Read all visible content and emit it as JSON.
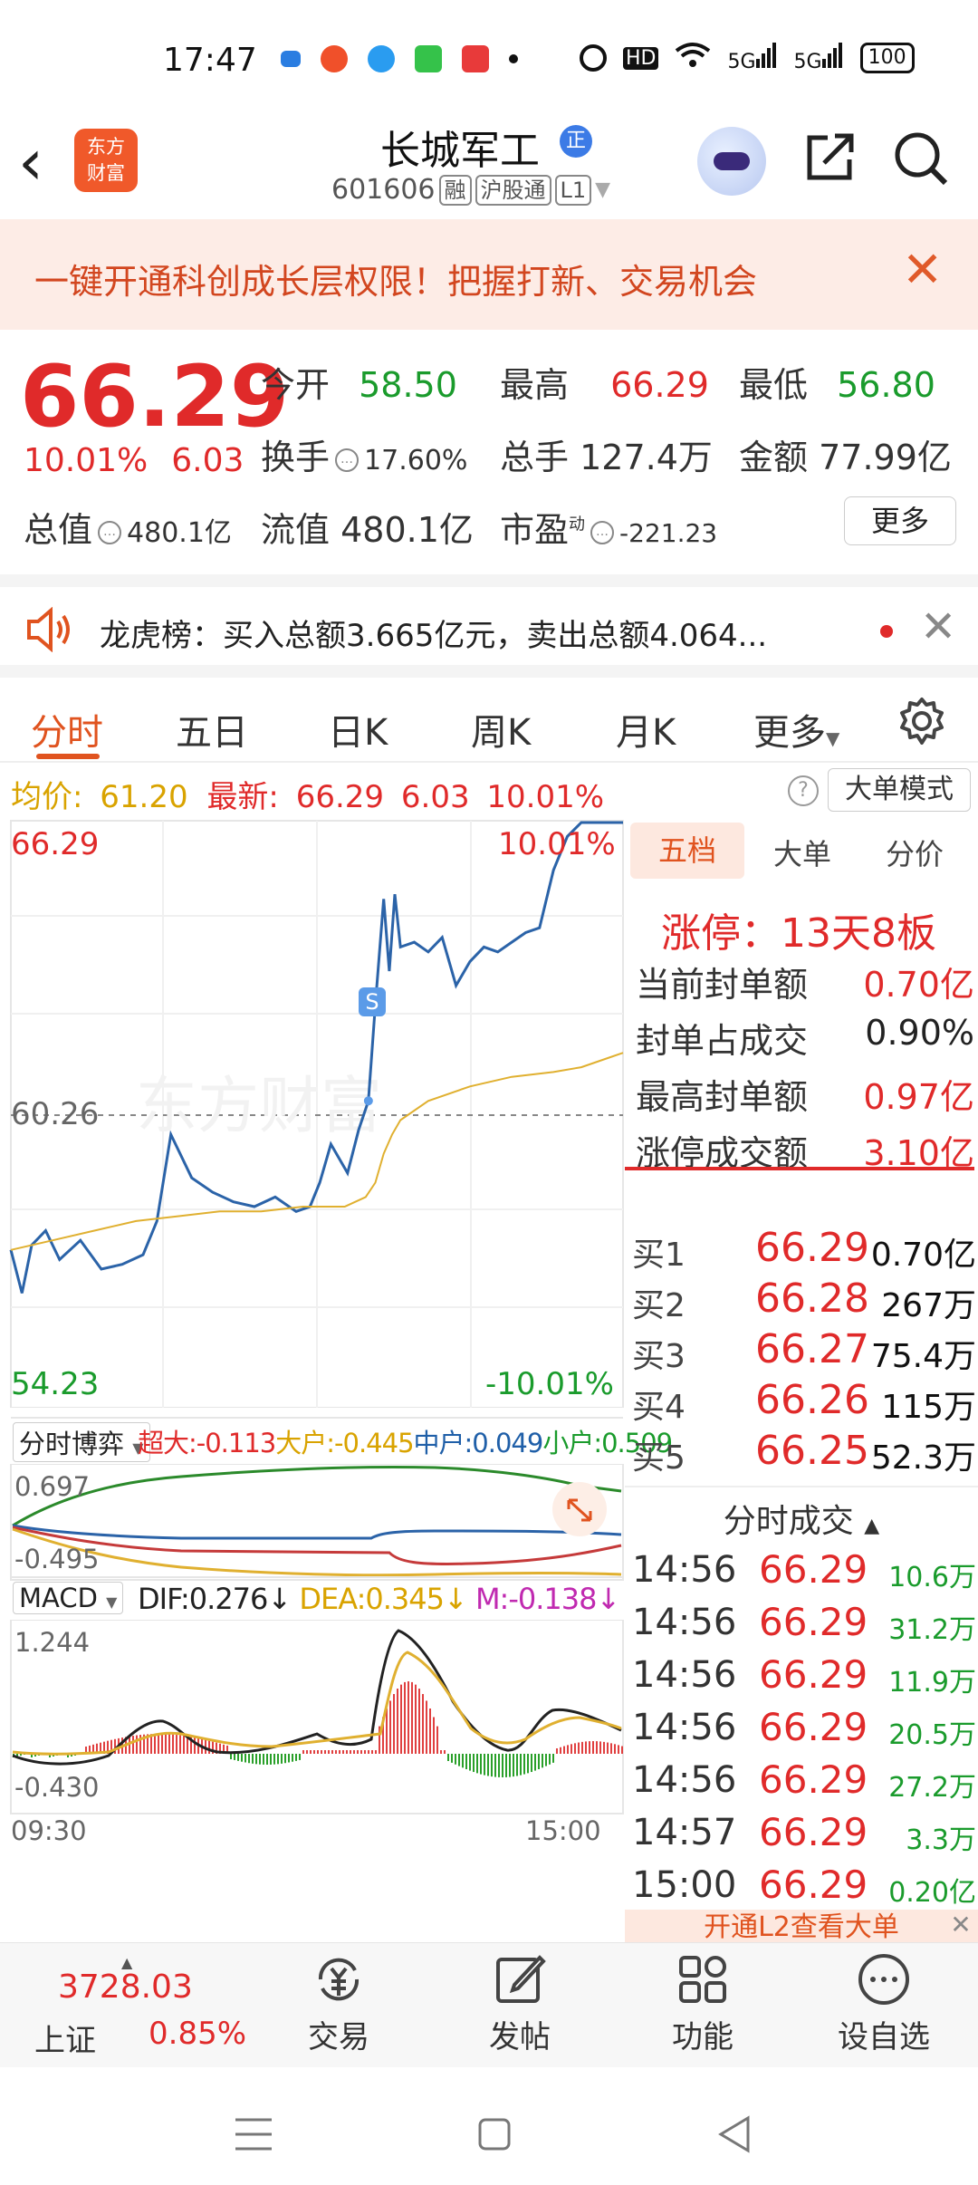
{
  "status_bar": {
    "time": "17:47",
    "network": "HD",
    "sig1": "5G",
    "sig2": "5G",
    "battery": "100"
  },
  "header": {
    "app_logo_line1": "东方",
    "app_logo_line2": "财富",
    "stock_name": "长城军工",
    "zheng_badge": "正",
    "stock_code": "601606",
    "tags": [
      "融",
      "沪股通",
      "L1"
    ]
  },
  "banner": {
    "text": "一键开通科创成长层权限！把握打新、交易机会"
  },
  "quote": {
    "price": "66.29",
    "change_pct": "10.01%",
    "change": "6.03",
    "open_label": "今开",
    "open": "58.50",
    "high_label": "最高",
    "high": "66.29",
    "low_label": "最低",
    "low": "56.80",
    "turnover_label": "换手",
    "turnover": "17.60%",
    "volume_label": "总手",
    "volume": "127.4万",
    "amount_label": "金额",
    "amount": "77.99亿",
    "mktcap_label": "总值",
    "mktcap": "480.1亿",
    "float_label": "流值",
    "float_cap": "480.1亿",
    "pe_label": "市盈",
    "pe_sup": "动",
    "pe": "-221.23",
    "more": "更多"
  },
  "dragon": {
    "text": "龙虎榜：买入总额3.665亿元，卖出总额4.064..."
  },
  "tabs": [
    "分时",
    "五日",
    "日K",
    "周K",
    "月K",
    "更多"
  ],
  "price_bar": {
    "avg_label": "均价:",
    "avg": "61.20",
    "last_label": "最新:",
    "last": "66.29",
    "chg": "6.03",
    "pct": "10.01%",
    "mode_btn": "大单模式"
  },
  "chart_labels": {
    "top_price": "66.29",
    "top_pct": "10.01%",
    "mid_price": "60.26",
    "bot_price": "54.23",
    "bot_pct": "-10.01%",
    "s_marker": "S",
    "fund_select": "分时博弈",
    "fund_super": "超大:-0.113",
    "fund_large": "大户:-0.445",
    "fund_mid": "中户:0.049",
    "fund_small": "小户:0.509",
    "fund_max": "0.697",
    "fund_min": "-0.495",
    "macd_select": "MACD",
    "dif": "DIF:0.276",
    "dea": "DEA:0.345",
    "m": "M:-0.138",
    "macd_max": "1.244",
    "macd_min": "-0.430",
    "t_start": "09:30",
    "t_end": "15:00",
    "watermark": "东方财富"
  },
  "chart_data": {
    "type": "line",
    "title": "",
    "ylim": [
      54.23,
      66.29
    ],
    "prev_close": 60.26,
    "series": [
      {
        "name": "",
        "color": "#2b63a8",
        "x": [
          0,
          8,
          15,
          25,
          35,
          50,
          65,
          80,
          95,
          105,
          115,
          130,
          145,
          160,
          175,
          190,
          205,
          215,
          222,
          230,
          242,
          250,
          257,
          262,
          268,
          272,
          276,
          280,
          290,
          300,
          310,
          320,
          330,
          340,
          350,
          360,
          370,
          380,
          390,
          400,
          410,
          420,
          430,
          440
        ],
        "values": [
          57.4,
          56.5,
          57.5,
          57.8,
          57.2,
          57.6,
          57.0,
          57.1,
          57.3,
          58.0,
          59.8,
          58.9,
          58.6,
          58.4,
          58.3,
          58.5,
          58.2,
          58.3,
          58.8,
          59.6,
          59.0,
          59.9,
          60.5,
          62.5,
          64.7,
          63.2,
          64.8,
          63.7,
          63.8,
          63.6,
          63.9,
          62.9,
          63.4,
          63.7,
          63.6,
          63.8,
          64.0,
          64.1,
          65.3,
          66.0,
          66.29,
          66.29,
          66.29,
          66.29
        ]
      },
      {
        "name": "均价",
        "color": "#e0b030",
        "x": [
          0,
          30,
          60,
          90,
          120,
          150,
          180,
          210,
          240,
          255,
          262,
          268,
          274,
          280,
          300,
          330,
          360,
          390,
          410,
          430,
          440
        ],
        "values": [
          57.4,
          57.6,
          57.8,
          58.0,
          58.1,
          58.2,
          58.2,
          58.3,
          58.3,
          58.5,
          58.8,
          59.4,
          59.8,
          60.1,
          60.5,
          60.8,
          61.0,
          61.1,
          61.2,
          61.4,
          61.5
        ]
      }
    ]
  },
  "side": {
    "tabs": [
      "五档",
      "大单",
      "分价"
    ],
    "limit_text": "涨停：13天8板",
    "rows": [
      {
        "k": "当前封单额",
        "v": "0.70亿"
      },
      {
        "k": "封单占成交",
        "v": "0.90%"
      },
      {
        "k": "最高封单额",
        "v": "0.97亿"
      },
      {
        "k": "涨停成交额",
        "v": "3.10亿"
      }
    ],
    "bids": [
      {
        "k": "买1",
        "p": "66.29",
        "q": "0.70亿"
      },
      {
        "k": "买2",
        "p": "66.28",
        "q": "267万"
      },
      {
        "k": "买3",
        "p": "66.27",
        "q": "75.4万"
      },
      {
        "k": "买4",
        "p": "66.26",
        "q": "115万"
      },
      {
        "k": "买5",
        "p": "66.25",
        "q": "52.3万"
      }
    ],
    "trades_title": "分时成交",
    "trades": [
      {
        "t": "14:56",
        "p": "66.29",
        "v": "10.6万"
      },
      {
        "t": "14:56",
        "p": "66.29",
        "v": "31.2万"
      },
      {
        "t": "14:56",
        "p": "66.29",
        "v": "11.9万"
      },
      {
        "t": "14:56",
        "p": "66.29",
        "v": "20.5万"
      },
      {
        "t": "14:56",
        "p": "66.29",
        "v": "27.2万"
      },
      {
        "t": "14:57",
        "p": "66.29",
        "v": "3.3万"
      },
      {
        "t": "15:00",
        "p": "66.29",
        "v": "0.20亿"
      }
    ],
    "l2_text": "开通L2查看大单"
  },
  "bottom_nav": {
    "index_value": "3728.03",
    "index_name": "上证",
    "index_pct": "0.85%",
    "items": [
      "交易",
      "发帖",
      "功能",
      "设自选"
    ]
  }
}
